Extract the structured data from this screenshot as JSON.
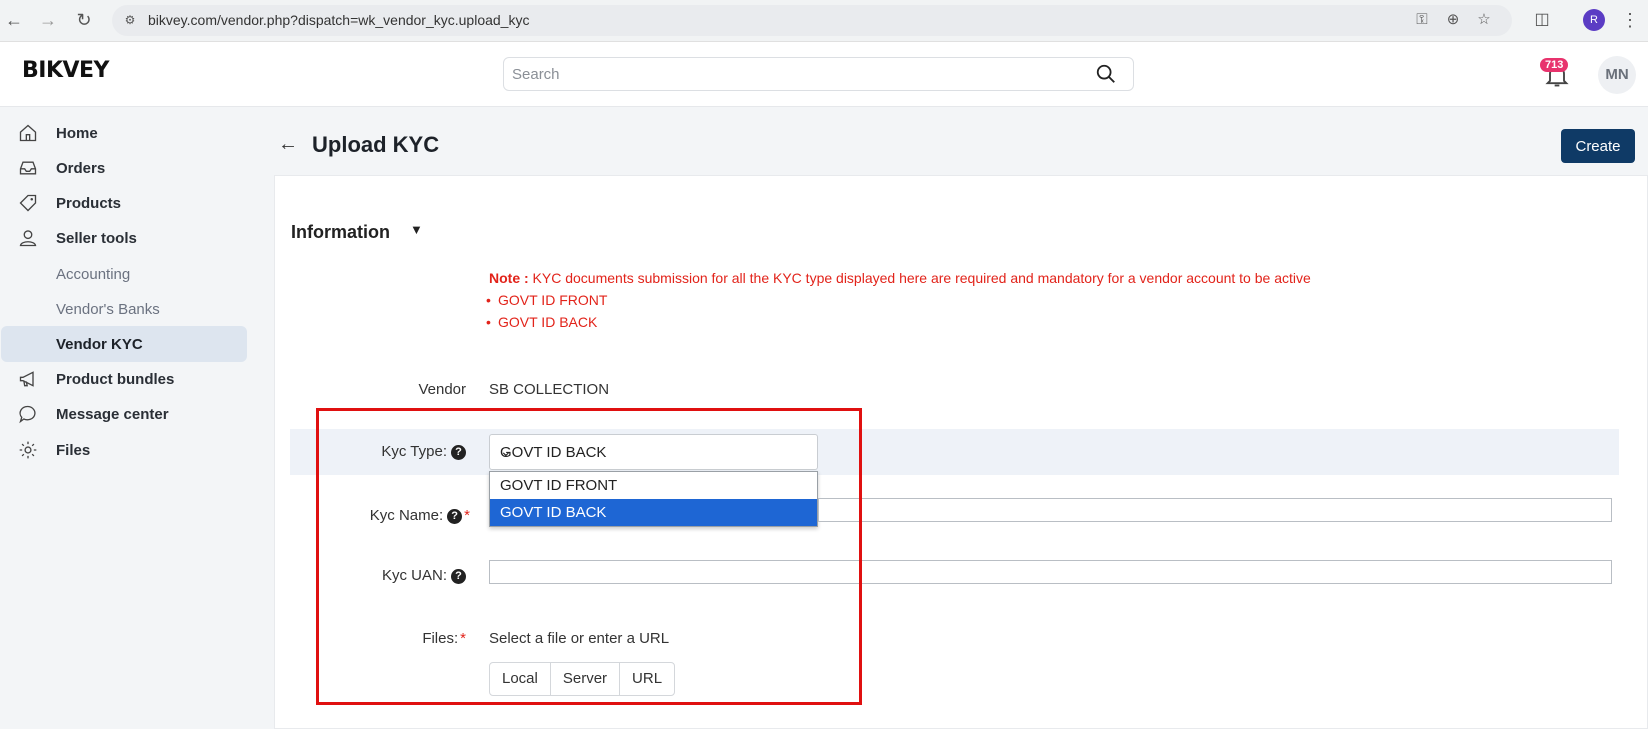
{
  "browser": {
    "url": "bikvey.com/vendor.php?dispatch=wk_vendor_kyc.upload_kyc",
    "profile_initial": "R"
  },
  "header": {
    "logo": "BIKVEY",
    "search_placeholder": "Search",
    "notification_count": "713",
    "avatar_initials": "MN"
  },
  "sidebar": {
    "items": [
      {
        "label": "Home",
        "icon": "home-icon"
      },
      {
        "label": "Orders",
        "icon": "inbox-icon"
      },
      {
        "label": "Products",
        "icon": "tag-icon"
      },
      {
        "label": "Seller tools",
        "icon": "user-icon"
      },
      {
        "label": "Accounting"
      },
      {
        "label": "Vendor's Banks"
      },
      {
        "label": "Vendor KYC",
        "active": true
      },
      {
        "label": "Product bundles",
        "icon": "megaphone-icon"
      },
      {
        "label": "Message center",
        "icon": "chat-icon"
      },
      {
        "label": "Files",
        "icon": "gear-icon"
      }
    ]
  },
  "page": {
    "title": "Upload KYC",
    "create_label": "Create",
    "section_title": "Information"
  },
  "note": {
    "prefix": "Note :",
    "text": " KYC documents submission for all the KYC type displayed here are required and mandatory for a vendor account to be active",
    "items": [
      "GOVT ID FRONT",
      "GOVT ID BACK"
    ]
  },
  "form": {
    "vendor_label": "Vendor",
    "vendor_value": "SB COLLECTION",
    "kyc_type_label": "Kyc Type:",
    "kyc_type_value": "GOVT ID BACK",
    "kyc_type_options": [
      "GOVT ID FRONT",
      "GOVT ID BACK"
    ],
    "kyc_name_label": "Kyc Name:",
    "kyc_name_value": "",
    "kyc_uan_label": "Kyc UAN:",
    "kyc_uan_value": "",
    "files_label": "Files:",
    "files_hint": "Select a file or enter a URL",
    "file_buttons": [
      "Local",
      "Server",
      "URL"
    ]
  }
}
